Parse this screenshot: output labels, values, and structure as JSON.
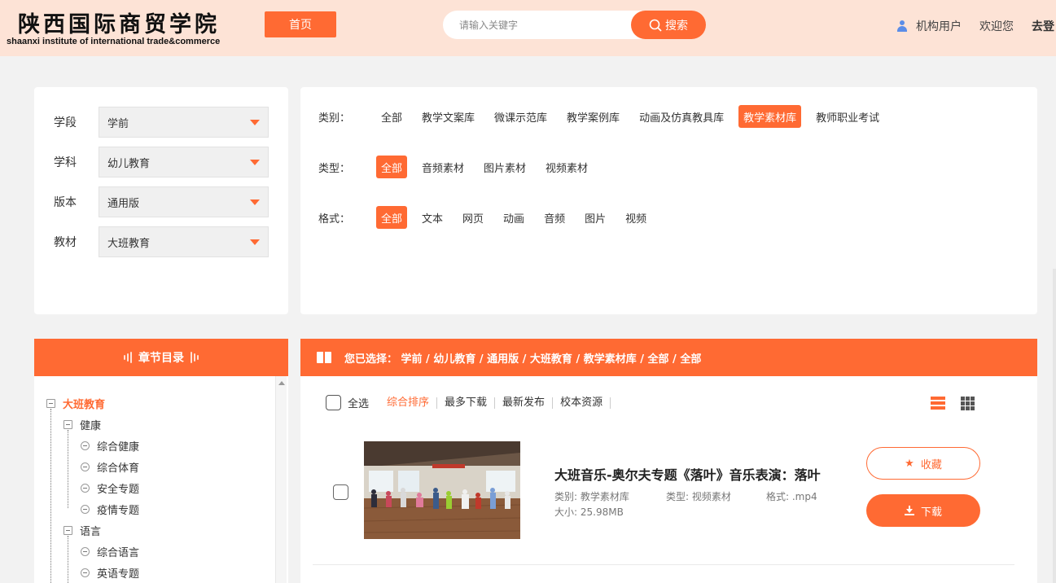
{
  "header": {
    "logo_cn": "陕西国际商贸学院",
    "logo_en": "shaanxi institute of international trade&commerce",
    "home_label": "首页",
    "search_placeholder": "请输入关键字",
    "search_label": "搜索",
    "user_type": "机构用户",
    "welcome": "欢迎您",
    "logout": "去登"
  },
  "filters": [
    {
      "label": "学段",
      "value": "学前"
    },
    {
      "label": "学科",
      "value": "幼儿教育"
    },
    {
      "label": "版本",
      "value": "通用版"
    },
    {
      "label": "教材",
      "value": "大班教育"
    }
  ],
  "categories": {
    "category_label": "类别：",
    "category_options": [
      "全部",
      "教学文案库",
      "微课示范库",
      "教学案例库",
      "动画及仿真教具库",
      "教学素材库",
      "教师职业考试"
    ],
    "category_active": "教学素材库",
    "type_label": "类型：",
    "type_options": [
      "全部",
      "音频素材",
      "图片素材",
      "视频素材"
    ],
    "type_active": "全部",
    "format_label": "格式：",
    "format_options": [
      "全部",
      "文本",
      "网页",
      "动画",
      "音频",
      "图片",
      "视频"
    ],
    "format_active": "全部"
  },
  "chapter": {
    "title": "章节目录",
    "tree": [
      {
        "level": 0,
        "label": "大班教育"
      },
      {
        "level": 1,
        "label": "健康"
      },
      {
        "level": 2,
        "label": "综合健康"
      },
      {
        "level": 2,
        "label": "综合体育"
      },
      {
        "level": 2,
        "label": "安全专题"
      },
      {
        "level": 2,
        "label": "疫情专题"
      },
      {
        "level": 1,
        "label": "语言"
      },
      {
        "level": 2,
        "label": "综合语言"
      },
      {
        "level": 2,
        "label": "英语专题"
      }
    ]
  },
  "results": {
    "selected_text": "您已选择： 学前 / 幼儿教育 / 通用版 / 大班教育 / 教学素材库 / 全部 / 全部",
    "select_all": "全选",
    "sort_options": [
      "综合排序",
      "最多下载",
      "最新发布",
      "校本资源"
    ],
    "sort_active": "综合排序",
    "items": [
      {
        "title": "大班音乐-奥尔夫专题《落叶》音乐表演：落叶",
        "category": "类别: 教学素材库",
        "type": "类型: 视频素材",
        "format": "格式: .mp4",
        "size": "大小: 25.98MB",
        "fav_label": "收藏",
        "download_label": "下载"
      }
    ]
  },
  "colors": {
    "accent": "#ff6a33",
    "header_bg": "#fde3d6",
    "page_bg": "#f2f2f2"
  }
}
